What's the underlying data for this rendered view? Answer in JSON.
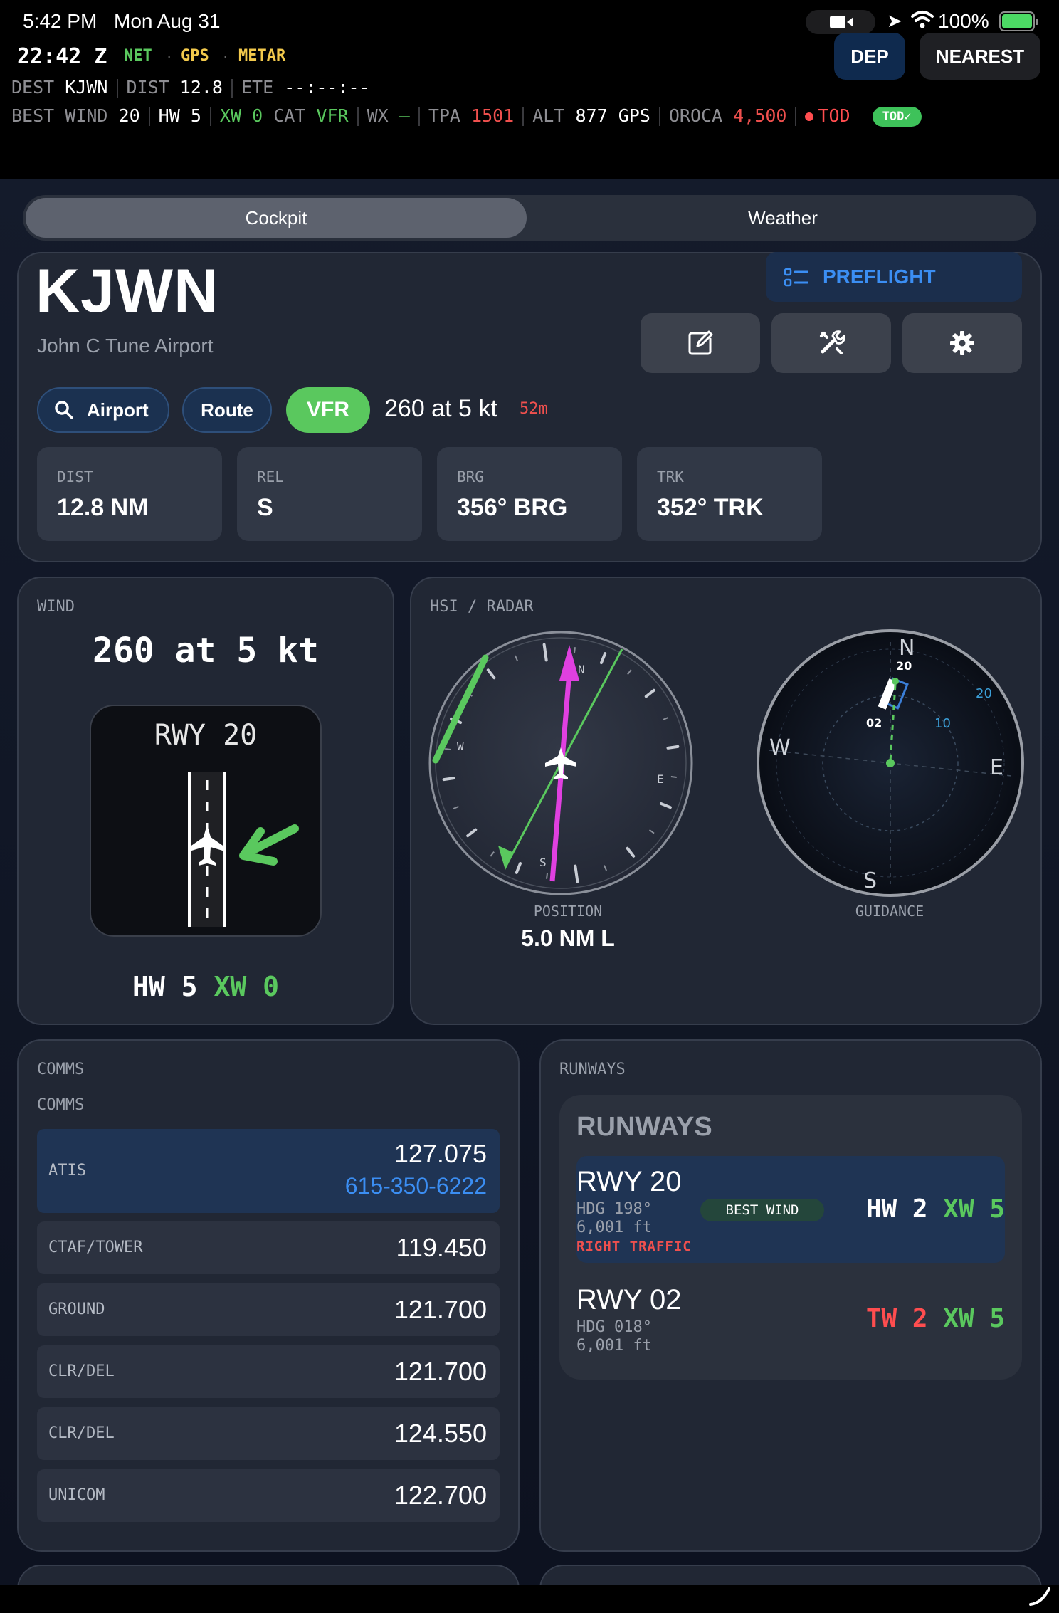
{
  "status": {
    "time": "5:42 PM",
    "date": "Mon Aug 31",
    "battery": "100%",
    "icons": [
      "camera-icon",
      "location-arrow-icon",
      "wifi-icon",
      "battery-charging-icon"
    ]
  },
  "header": {
    "zulu": "22:42 Z",
    "sources": [
      "NET",
      "GPS",
      "METAR"
    ],
    "source_colors": {
      "NET": "#5ac85e",
      "GPS": "#f2c94c",
      "METAR": "#f2c94c"
    },
    "dep_label": "DEP",
    "nearest_label": "NEAREST",
    "dest_label": "DEST",
    "dest_value": "KJWN",
    "dist_label": "DIST",
    "dist_value": "12.8",
    "ete_label": "ETE",
    "ete_value": "--:--:--",
    "best_label": "BEST",
    "wind_label": "WIND",
    "wind_value": "20",
    "hw_label": "HW",
    "hw_value": "5",
    "xw_label": "XW",
    "xw_value": "0",
    "cat_label": "CAT",
    "cat_value": "VFR",
    "wx_label": "WX",
    "wx_value": "—",
    "tpa_label": "TPA",
    "tpa_value": "1501",
    "alt_label": "ALT",
    "alt_value": "877",
    "alt_src": "GPS",
    "oroca_label": "OROCA",
    "oroca_value": "4,500",
    "tod_label": "TOD",
    "tod_pill": "TOD✓"
  },
  "tabs": [
    {
      "label": "Cockpit",
      "active": true
    },
    {
      "label": "Weather",
      "active": false
    }
  ],
  "airport": {
    "id": "KJWN",
    "name": "John C Tune Airport",
    "preflight_label": "PREFLIGHT",
    "airport_btn": "Airport",
    "route_btn": "Route",
    "category": "VFR",
    "wind_text": "260 at 5 kt",
    "wx_age": "52m",
    "stats": [
      {
        "key": "DIST",
        "value": "12.8 NM"
      },
      {
        "key": "REL",
        "value": "S"
      },
      {
        "key": "BRG",
        "value": "356° BRG"
      },
      {
        "key": "TRK",
        "value": "352° TRK"
      }
    ]
  },
  "wind": {
    "title": "WIND",
    "text": "260 at 5 kt",
    "runway_label": "RWY 20",
    "hw_label": "HW",
    "hw_value": "5",
    "xw_label": "XW",
    "xw_value": "0"
  },
  "hsi": {
    "title": "HSI / RADAR",
    "position_caption": "POSITION",
    "position_value": "5.0 NM L",
    "guidance_caption": "GUIDANCE",
    "compass_letters": [
      "N",
      "E",
      "S",
      "W"
    ],
    "radar_rings": [
      "10",
      "20"
    ],
    "radar_runway_ends": [
      "20",
      "02"
    ]
  },
  "comms": {
    "title": "COMMS",
    "subtitle": "COMMS",
    "rows": [
      {
        "name": "ATIS",
        "freq": "127.075",
        "phone": "615-350-6222",
        "highlight": true
      },
      {
        "name": "CTAF/TOWER",
        "freq": "119.450"
      },
      {
        "name": "GROUND",
        "freq": "121.700"
      },
      {
        "name": "CLR/DEL",
        "freq": "121.700"
      },
      {
        "name": "CLR/DEL",
        "freq": "124.550"
      },
      {
        "name": "UNICOM",
        "freq": "122.700"
      }
    ]
  },
  "runways": {
    "title": "RUNWAYS",
    "heading": "RUNWAYS",
    "items": [
      {
        "name": "RWY 20",
        "hdg": "HDG 198°",
        "length": "6,001 ft",
        "traffic": "RIGHT TRAFFIC",
        "badge": "BEST WIND",
        "c1_label": "HW",
        "c1_value": "2",
        "xw_label": "XW",
        "xw_value": "5"
      },
      {
        "name": "RWY 02",
        "hdg": "HDG 018°",
        "length": "6,001 ft",
        "c1_label": "TW",
        "c1_value": "2",
        "xw_label": "XW",
        "xw_value": "5"
      }
    ]
  },
  "colors": {
    "accent_blue": "#3b8ef3",
    "vfr_green": "#5ac85e",
    "alert_red": "#f0504e",
    "magenta": "#e040e0"
  }
}
